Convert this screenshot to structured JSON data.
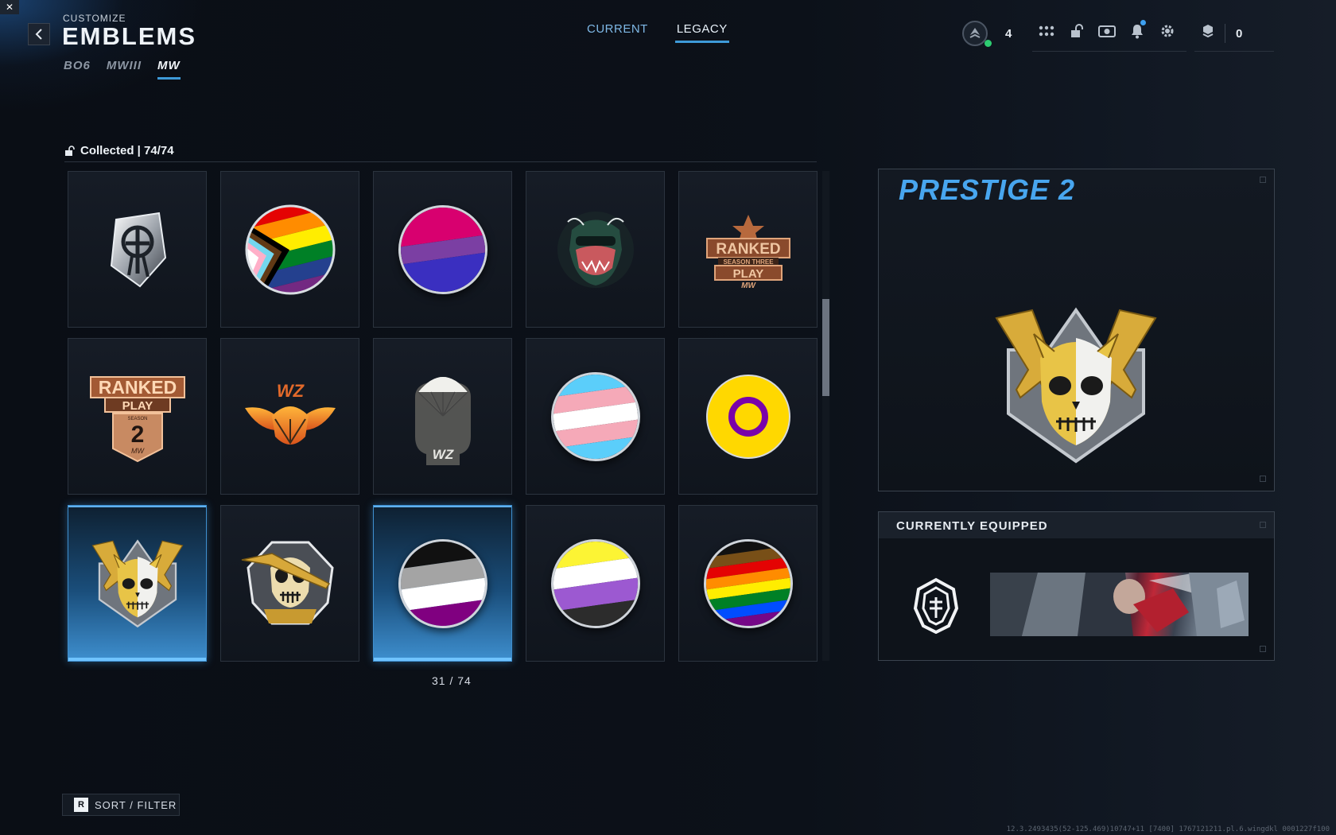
{
  "header": {
    "subtitle": "CUSTOMIZE",
    "title": "EMBLEMS",
    "game_tabs": [
      {
        "label": "BO6",
        "active": false
      },
      {
        "label": "MWIII",
        "active": false
      },
      {
        "label": "MW",
        "active": true
      }
    ],
    "view_tabs": [
      {
        "label": "CURRENT",
        "active": false
      },
      {
        "label": "LEGACY",
        "active": true
      }
    ],
    "rank_level": "4",
    "cod_points": "0",
    "hud_icons": [
      "squad-icon",
      "unlock-icon",
      "store-icon",
      "notification-bell-icon",
      "settings-gear-icon"
    ],
    "x_badge": "✕"
  },
  "collection": {
    "label": "Collected | 74/74",
    "counter": "31 / 74"
  },
  "emblems": [
    {
      "name": "emblem-silver-spartan",
      "kind": "image",
      "selected": false
    },
    {
      "name": "emblem-progress-pride-flag",
      "kind": "disc",
      "selected": false
    },
    {
      "name": "emblem-bisexual-flag",
      "kind": "disc",
      "selected": false,
      "bands": [
        "#d8006f",
        "#7b3fa3",
        "#3a2fc0"
      ]
    },
    {
      "name": "emblem-oni-mask",
      "kind": "image",
      "selected": false
    },
    {
      "name": "emblem-ranked-play-season-three",
      "kind": "image",
      "selected": false
    },
    {
      "name": "emblem-ranked-play-season-2",
      "kind": "image",
      "selected": false
    },
    {
      "name": "emblem-wz-winged-parachute",
      "kind": "image",
      "selected": false
    },
    {
      "name": "emblem-wz-parachute-skull",
      "kind": "image",
      "selected": false
    },
    {
      "name": "emblem-transgender-flag",
      "kind": "disc",
      "selected": false,
      "bands": [
        "#5bcefa",
        "#f5a9b8",
        "#ffffff",
        "#f5a9b8",
        "#5bcefa"
      ]
    },
    {
      "name": "emblem-intersex-flag",
      "kind": "intersex",
      "selected": false
    },
    {
      "name": "emblem-prestige-2",
      "kind": "image",
      "selected": true
    },
    {
      "name": "emblem-gold-skull-knife",
      "kind": "image",
      "selected": false
    },
    {
      "name": "emblem-asexual-flag",
      "kind": "disc",
      "selected": true,
      "bands": [
        "#111111",
        "#a4a4a4",
        "#ffffff",
        "#800080"
      ]
    },
    {
      "name": "emblem-nonbinary-flag",
      "kind": "disc",
      "selected": false,
      "bands": [
        "#fcf434",
        "#ffffff",
        "#9c59d1",
        "#2c2c2c"
      ]
    },
    {
      "name": "emblem-rainbow-pride-flag",
      "kind": "disc",
      "selected": false,
      "bands": [
        "#111111",
        "#784f17",
        "#e40303",
        "#ff8c00",
        "#ffed00",
        "#008026",
        "#004dff",
        "#750787"
      ]
    }
  ],
  "preview": {
    "title": "PRESTIGE 2"
  },
  "equipped": {
    "label": "CURRENTLY EQUIPPED"
  },
  "footer": {
    "sort_key": "R",
    "sort_label": "SORT / FILTER",
    "build_info": "12.3.2493435(52-125.469)10747+11 [7400] 1767121211.pl.6.wingdkl 0001227f100"
  },
  "colors": {
    "accent": "#3e9ad8",
    "prestige_title": "#48a6ef",
    "background": "#0b0f16"
  }
}
